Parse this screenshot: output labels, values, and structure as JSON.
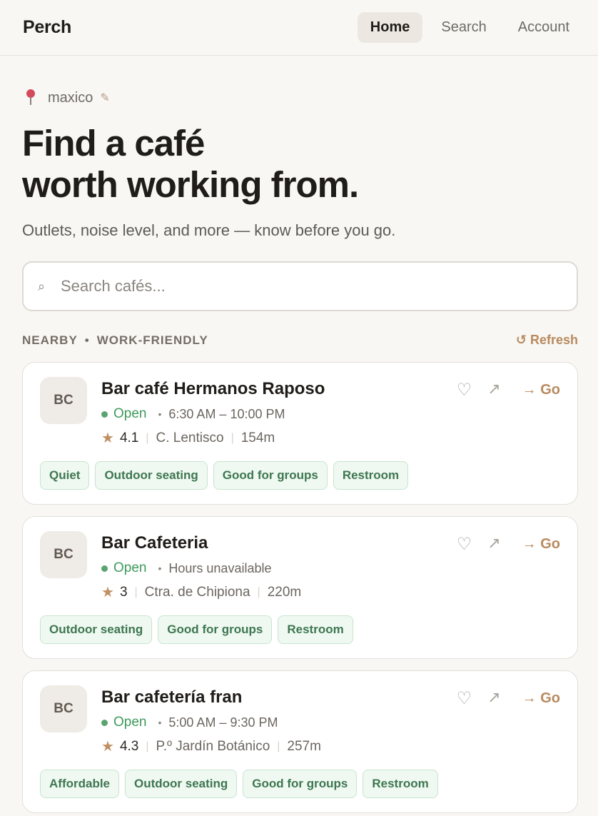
{
  "app": {
    "brand": "Perch"
  },
  "nav": {
    "home": "Home",
    "search": "Search",
    "account": "Account"
  },
  "location": {
    "name": "maxico",
    "edit_icon": "pencil-icon",
    "pin_icon": "pin-icon"
  },
  "hero": {
    "line1": "Find a café",
    "line2": "worth working from.",
    "subtitle": "Outlets, noise level, and more — know before you go."
  },
  "search": {
    "placeholder": "Search cafés...",
    "value": "",
    "icon": "⌕"
  },
  "section": {
    "label1": "NEARBY",
    "dot": "•",
    "label2": "WORK-FRIENDLY",
    "refresh": "↺ Refresh"
  },
  "colors": {
    "accent": "#b88a5e",
    "open": "#3f9a5c",
    "tag_bg": "#eff9f1",
    "tag_text": "#3e7651"
  },
  "cafes": [
    {
      "initials": "BC",
      "name": "Bar café Hermanos Raposo",
      "status": "Open",
      "hours": "6:30 AM – 10:00 PM",
      "rating": "4.1",
      "street": "C. Lentisco",
      "distance": "154m",
      "tags": [
        "Quiet",
        "Outdoor seating",
        "Good for groups",
        "Restroom"
      ],
      "go": "→ Go"
    },
    {
      "initials": "BC",
      "name": "Bar Cafeteria",
      "status": "Open",
      "hours": "Hours unavailable",
      "rating": "3",
      "street": "Ctra. de Chipiona",
      "distance": "220m",
      "tags": [
        "Outdoor seating",
        "Good for groups",
        "Restroom"
      ],
      "go": "→ Go"
    },
    {
      "initials": "BC",
      "name": "Bar cafetería fran",
      "status": "Open",
      "hours": "5:00 AM – 9:30 PM",
      "rating": "4.3",
      "street": "P.º Jardín Botánico",
      "distance": "257m",
      "tags": [
        "Affordable",
        "Outdoor seating",
        "Good for groups",
        "Restroom"
      ],
      "go": "→ Go"
    }
  ]
}
